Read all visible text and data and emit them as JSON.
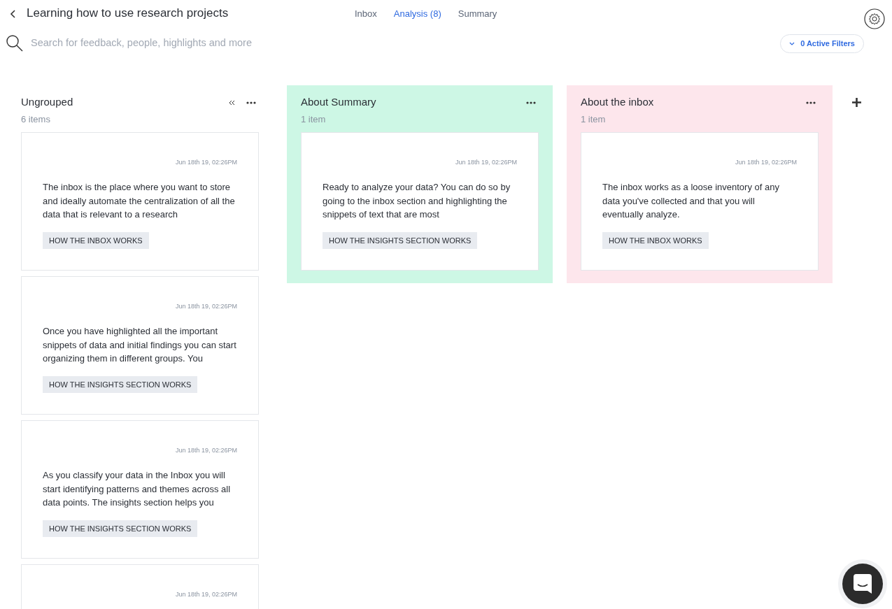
{
  "header": {
    "title": "Learning how to use research projects",
    "tabs": [
      {
        "label": "Inbox",
        "selected": false
      },
      {
        "label": "Analysis (8)",
        "selected": true
      },
      {
        "label": "Summary",
        "selected": false
      }
    ]
  },
  "search": {
    "placeholder": "Search for feedback, people, highlights and more"
  },
  "filters": {
    "label": "0 Active Filters"
  },
  "groups": [
    {
      "title": "Ungrouped",
      "count": "6 items",
      "collapsible": true,
      "color": "#ffffff",
      "cards": [
        {
          "date": "Jun 18th 19, 02:26PM",
          "text": "The inbox is the place where you want to store and ideally automate the centralization of all the data that is relevant to a research",
          "tag": "HOW THE INBOX WORKS"
        },
        {
          "date": "Jun 18th 19, 02:26PM",
          "text": "Once you have highlighted all the important snippets of data and initial findings you can start organizing them in different groups. You",
          "tag": "HOW THE INSIGHTS SECTION WORKS"
        },
        {
          "date": "Jun 18th 19, 02:26PM",
          "text": "As you classify your data in the Inbox you will start identifying patterns and themes across all data points. The insights section helps you",
          "tag": "HOW THE INSIGHTS SECTION WORKS"
        },
        {
          "date": "Jun 18th 19, 02:26PM"
        }
      ]
    },
    {
      "title": "About Summary",
      "count": "1 item",
      "collapsible": false,
      "color": "#cdf7e5",
      "cards": [
        {
          "date": "Jun 18th 19, 02:26PM",
          "text": "Ready to analyze your data? You can do so by going to the inbox section and highlighting the snippets of text that are most",
          "tag": "HOW THE INSIGHTS SECTION WORKS"
        }
      ]
    },
    {
      "title": "About the inbox",
      "count": "1 item",
      "collapsible": false,
      "color": "#fde6ec",
      "cards": [
        {
          "date": "Jun 18th 19, 02:26PM",
          "text": "The inbox works as a loose inventory of any data you've collected and that you will eventually analyze.",
          "tag": "HOW THE INBOX WORKS"
        }
      ]
    }
  ]
}
